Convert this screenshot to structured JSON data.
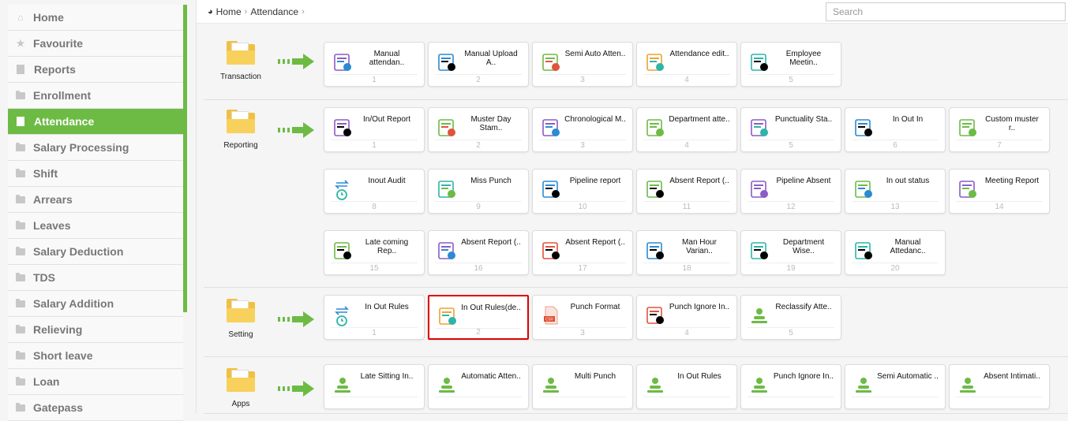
{
  "sidebar": {
    "items": [
      {
        "label": "Home",
        "icon": "home-icon",
        "active": false
      },
      {
        "label": "Favourite",
        "icon": "star-icon",
        "active": false
      },
      {
        "label": "Reports",
        "icon": "document-icon",
        "active": false
      },
      {
        "label": "Enrollment",
        "icon": "folder-icon",
        "active": false
      },
      {
        "label": "Attendance",
        "icon": "document-icon",
        "active": true
      },
      {
        "label": "Salary Processing",
        "icon": "folder-icon",
        "active": false
      },
      {
        "label": "Shift",
        "icon": "folder-icon",
        "active": false
      },
      {
        "label": "Arrears",
        "icon": "folder-icon",
        "active": false
      },
      {
        "label": "Leaves",
        "icon": "folder-icon",
        "active": false
      },
      {
        "label": "Salary Deduction",
        "icon": "folder-icon",
        "active": false
      },
      {
        "label": "TDS",
        "icon": "folder-icon",
        "active": false
      },
      {
        "label": "Salary Addition",
        "icon": "folder-icon",
        "active": false
      },
      {
        "label": "Relieving",
        "icon": "folder-icon",
        "active": false
      },
      {
        "label": "Short leave",
        "icon": "folder-icon",
        "active": false
      },
      {
        "label": "Loan",
        "icon": "folder-icon",
        "active": false
      },
      {
        "label": "Gatepass",
        "icon": "folder-icon",
        "active": false
      }
    ]
  },
  "breadcrumb": {
    "home": "Home",
    "current": "Attendance",
    "separator": "›"
  },
  "search": {
    "placeholder": "Search",
    "value": ""
  },
  "colors": {
    "accent": "#6dbb45",
    "highlight": "#e00000",
    "folder": "#f0c040"
  },
  "sections": [
    {
      "label": "Transaction",
      "tiles": [
        {
          "title": "Manual attendan..",
          "num": "1",
          "icon": "manual-attendance-icon"
        },
        {
          "title": "Manual Upload A..",
          "num": "2",
          "icon": "calendar-upload-icon"
        },
        {
          "title": "Semi Auto Atten..",
          "num": "3",
          "icon": "semi-auto-icon"
        },
        {
          "title": "Attendance edit..",
          "num": "4",
          "icon": "calendar-edit-icon"
        },
        {
          "title": "Employee Meetin..",
          "num": "5",
          "icon": "meeting-icon"
        }
      ]
    },
    {
      "label": "Reporting",
      "tiles": [
        {
          "title": "In/Out Report",
          "num": "1",
          "icon": "report-icon"
        },
        {
          "title": "Muster Day Stam..",
          "num": "2",
          "icon": "chart-icon"
        },
        {
          "title": "Chronological M..",
          "num": "3",
          "icon": "chronological-icon"
        },
        {
          "title": "Department atte..",
          "num": "4",
          "icon": "department-icon"
        },
        {
          "title": "Punctuality Sta..",
          "num": "5",
          "icon": "punctuality-icon"
        },
        {
          "title": "In Out In",
          "num": "6",
          "icon": "door-icon"
        },
        {
          "title": "Custom muster r..",
          "num": "7",
          "icon": "custom-muster-icon"
        },
        {
          "title": "Inout Audit",
          "num": "8",
          "icon": "audit-clock-icon"
        },
        {
          "title": "Miss Punch",
          "num": "9",
          "icon": "hand-icon"
        },
        {
          "title": "Pipeline report",
          "num": "10",
          "icon": "pipeline-icon"
        },
        {
          "title": "Absent Report (..",
          "num": "11",
          "icon": "absent-report-icon"
        },
        {
          "title": "Pipeline Absent",
          "num": "12",
          "icon": "pipeline-absent-icon"
        },
        {
          "title": "In out status",
          "num": "13",
          "icon": "status-icon"
        },
        {
          "title": "Meeting Report",
          "num": "14",
          "icon": "meeting-report-icon"
        },
        {
          "title": "Late coming Rep..",
          "num": "15",
          "icon": "late-coming-icon"
        },
        {
          "title": "Absent Report (..",
          "num": "16",
          "icon": "absent-calendar-icon"
        },
        {
          "title": "Absent Report (..",
          "num": "17",
          "icon": "absent-person-icon"
        },
        {
          "title": "Man Hour Varian..",
          "num": "18",
          "icon": "man-hour-chart-icon"
        },
        {
          "title": "Department Wise..",
          "num": "19",
          "icon": "department-chart-icon"
        },
        {
          "title": "Manual Attedanc..",
          "num": "20",
          "icon": "manual-chart-icon"
        }
      ]
    },
    {
      "label": "Setting",
      "tiles": [
        {
          "title": "In Out Rules",
          "num": "1",
          "icon": "rules-clock-icon"
        },
        {
          "title": "In Out Rules(de..",
          "num": "2",
          "icon": "rules-settings-icon",
          "highlighted": true
        },
        {
          "title": "Punch Format",
          "num": "3",
          "icon": "csv-file-icon"
        },
        {
          "title": "Punch Ignore In..",
          "num": "4",
          "icon": "punch-ignore-icon"
        },
        {
          "title": "Reclassify Atte..",
          "num": "5",
          "icon": "person-icon"
        }
      ]
    },
    {
      "label": "Apps",
      "tiles": [
        {
          "title": "Late Sitting In..",
          "num": "",
          "icon": "person-icon"
        },
        {
          "title": "Automatic Atten..",
          "num": "",
          "icon": "person-icon"
        },
        {
          "title": "Multi Punch",
          "num": "",
          "icon": "person-icon"
        },
        {
          "title": "In Out Rules",
          "num": "",
          "icon": "person-icon"
        },
        {
          "title": "Punch Ignore In..",
          "num": "",
          "icon": "person-icon"
        },
        {
          "title": "Semi Automatic ..",
          "num": "",
          "icon": "person-icon"
        },
        {
          "title": "Absent Intimati..",
          "num": "",
          "icon": "person-icon"
        }
      ]
    }
  ]
}
